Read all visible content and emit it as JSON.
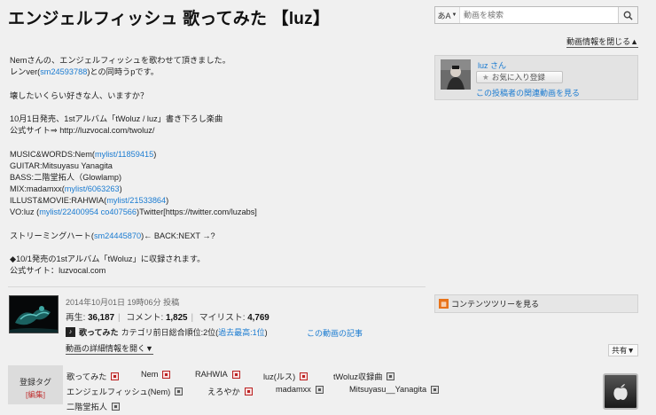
{
  "title": "エンジェルフィッシュ 歌ってみた 【luz】",
  "search": {
    "lang_label": "あA",
    "placeholder": "動画を検索"
  },
  "close_info_label": "動画情報を閉じる▲",
  "description": [
    {
      "parts": [
        {
          "t": "Nemさんの、エンジェルフィッシュを歌わせて頂きました。"
        }
      ]
    },
    {
      "parts": [
        {
          "t": "レンver("
        },
        {
          "t": "sm24593788",
          "link": true
        },
        {
          "t": ")との同時うpです。"
        }
      ]
    },
    {
      "blank": true
    },
    {
      "parts": [
        {
          "t": "壊したいくらい好きな人、いますか？"
        }
      ]
    },
    {
      "blank": true
    },
    {
      "parts": [
        {
          "t": "10月1日発売、1stアルバム「tWoluz / luz」書き下ろし楽曲"
        }
      ]
    },
    {
      "parts": [
        {
          "t": "公式サイト⇒ http://luzvocal.com/twoluz/"
        }
      ]
    },
    {
      "blank": true
    },
    {
      "parts": [
        {
          "t": "MUSIC&WORDS:Nem("
        },
        {
          "t": "mylist/11859415",
          "link": true
        },
        {
          "t": ")"
        }
      ]
    },
    {
      "parts": [
        {
          "t": "GUITAR:Mitsuyasu Yanagita"
        }
      ]
    },
    {
      "parts": [
        {
          "t": "BASS:二階堂拓人（Glowlamp)"
        }
      ]
    },
    {
      "parts": [
        {
          "t": "MIX:madamxx("
        },
        {
          "t": "mylist/6063263",
          "link": true
        },
        {
          "t": ")"
        }
      ]
    },
    {
      "parts": [
        {
          "t": "ILLUST&MOVIE:RAHWIA("
        },
        {
          "t": "mylist/21533864",
          "link": true
        },
        {
          "t": ")"
        }
      ]
    },
    {
      "parts": [
        {
          "t": "VO:luz ("
        },
        {
          "t": "mylist/22400954",
          "link": true
        },
        {
          "t": " "
        },
        {
          "t": "co407566",
          "link": true
        },
        {
          "t": ")Twitter[https://twitter.com/luzabs]"
        }
      ]
    },
    {
      "blank": true
    },
    {
      "parts": [
        {
          "t": "ストリーミングハート("
        },
        {
          "t": "sm24445870",
          "link": true
        },
        {
          "t": ")← BACK:NEXT →?"
        }
      ]
    },
    {
      "blank": true
    },
    {
      "parts": [
        {
          "t": "◆10/1発売の1stアルバム「tWoluz」に収録されます。"
        }
      ]
    },
    {
      "parts": [
        {
          "t": "公式サイト：luzvocal.com"
        }
      ]
    }
  ],
  "uploader": {
    "name": "luz さん",
    "fav_label": "お気に入り登録",
    "related_label": "この投稿者の関連動画を見る"
  },
  "post_date": "2014年10月01日 19時06分 投稿",
  "stats": {
    "views_label": "再生:",
    "views": "36,187",
    "comments_label": "コメント:",
    "comments": "1,825",
    "mylist_label": "マイリスト:",
    "mylist": "4,769"
  },
  "category": {
    "name": "歌ってみた",
    "rank_text": "カテゴリ前日総合順位:2位(",
    "rank_best": "過去最高:1位",
    "rank_close": ")"
  },
  "article_link": "この動画の記事",
  "contents_tree_label": "コンテンツツリーを見る",
  "details_link": "動画の詳細情報を開く▼",
  "share_label": "共有▼",
  "tags": {
    "box_label": "登録タグ",
    "edit_label": "[編集]",
    "items": [
      {
        "name": "歌ってみた",
        "lock": "red"
      },
      {
        "name": "Nem",
        "lock": "red"
      },
      {
        "name": "RAHWIA",
        "lock": "red"
      },
      {
        "name": "luz(ルス)",
        "lock": "red"
      },
      {
        "name": "tWoluz収録曲",
        "lock": "gray"
      },
      {
        "name": "エンジェルフィッシュ(Nem)",
        "lock": "gray"
      },
      {
        "name": "えろやか",
        "lock": "red"
      },
      {
        "name": "madamxx",
        "lock": "gray"
      },
      {
        "name": "Mitsuyasu__Yanagita",
        "lock": "gray"
      },
      {
        "name": "二階堂拓人",
        "lock": "gray"
      }
    ]
  },
  "colors": {
    "link": "#1a7bd1",
    "background": "#f0f0f0",
    "tag_lock_red": "#b22222"
  }
}
